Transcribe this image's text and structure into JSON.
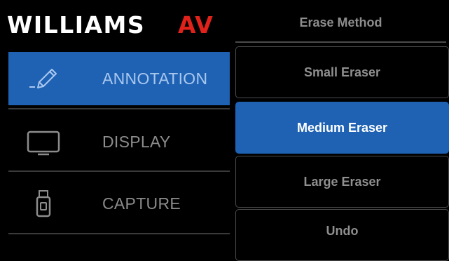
{
  "brand": {
    "name": "WILLIAMS AV",
    "text_part": "WILLIAMS",
    "accent_part": "AV",
    "accent_color": "#e0221b"
  },
  "sidebar": {
    "items": [
      {
        "label": "ANNOTATION",
        "icon": "pen-icon",
        "active": true
      },
      {
        "label": "DISPLAY",
        "icon": "monitor-icon",
        "active": false
      },
      {
        "label": "CAPTURE",
        "icon": "usb-drive-icon",
        "active": false
      }
    ]
  },
  "panel": {
    "title": "Erase Method",
    "options": [
      {
        "label": "Small Eraser",
        "selected": false
      },
      {
        "label": "Medium Eraser",
        "selected": true
      },
      {
        "label": "Large Eraser",
        "selected": false
      },
      {
        "label": "Undo",
        "selected": false
      }
    ]
  },
  "colors": {
    "accent": "#1f62b4",
    "background": "#000000"
  }
}
